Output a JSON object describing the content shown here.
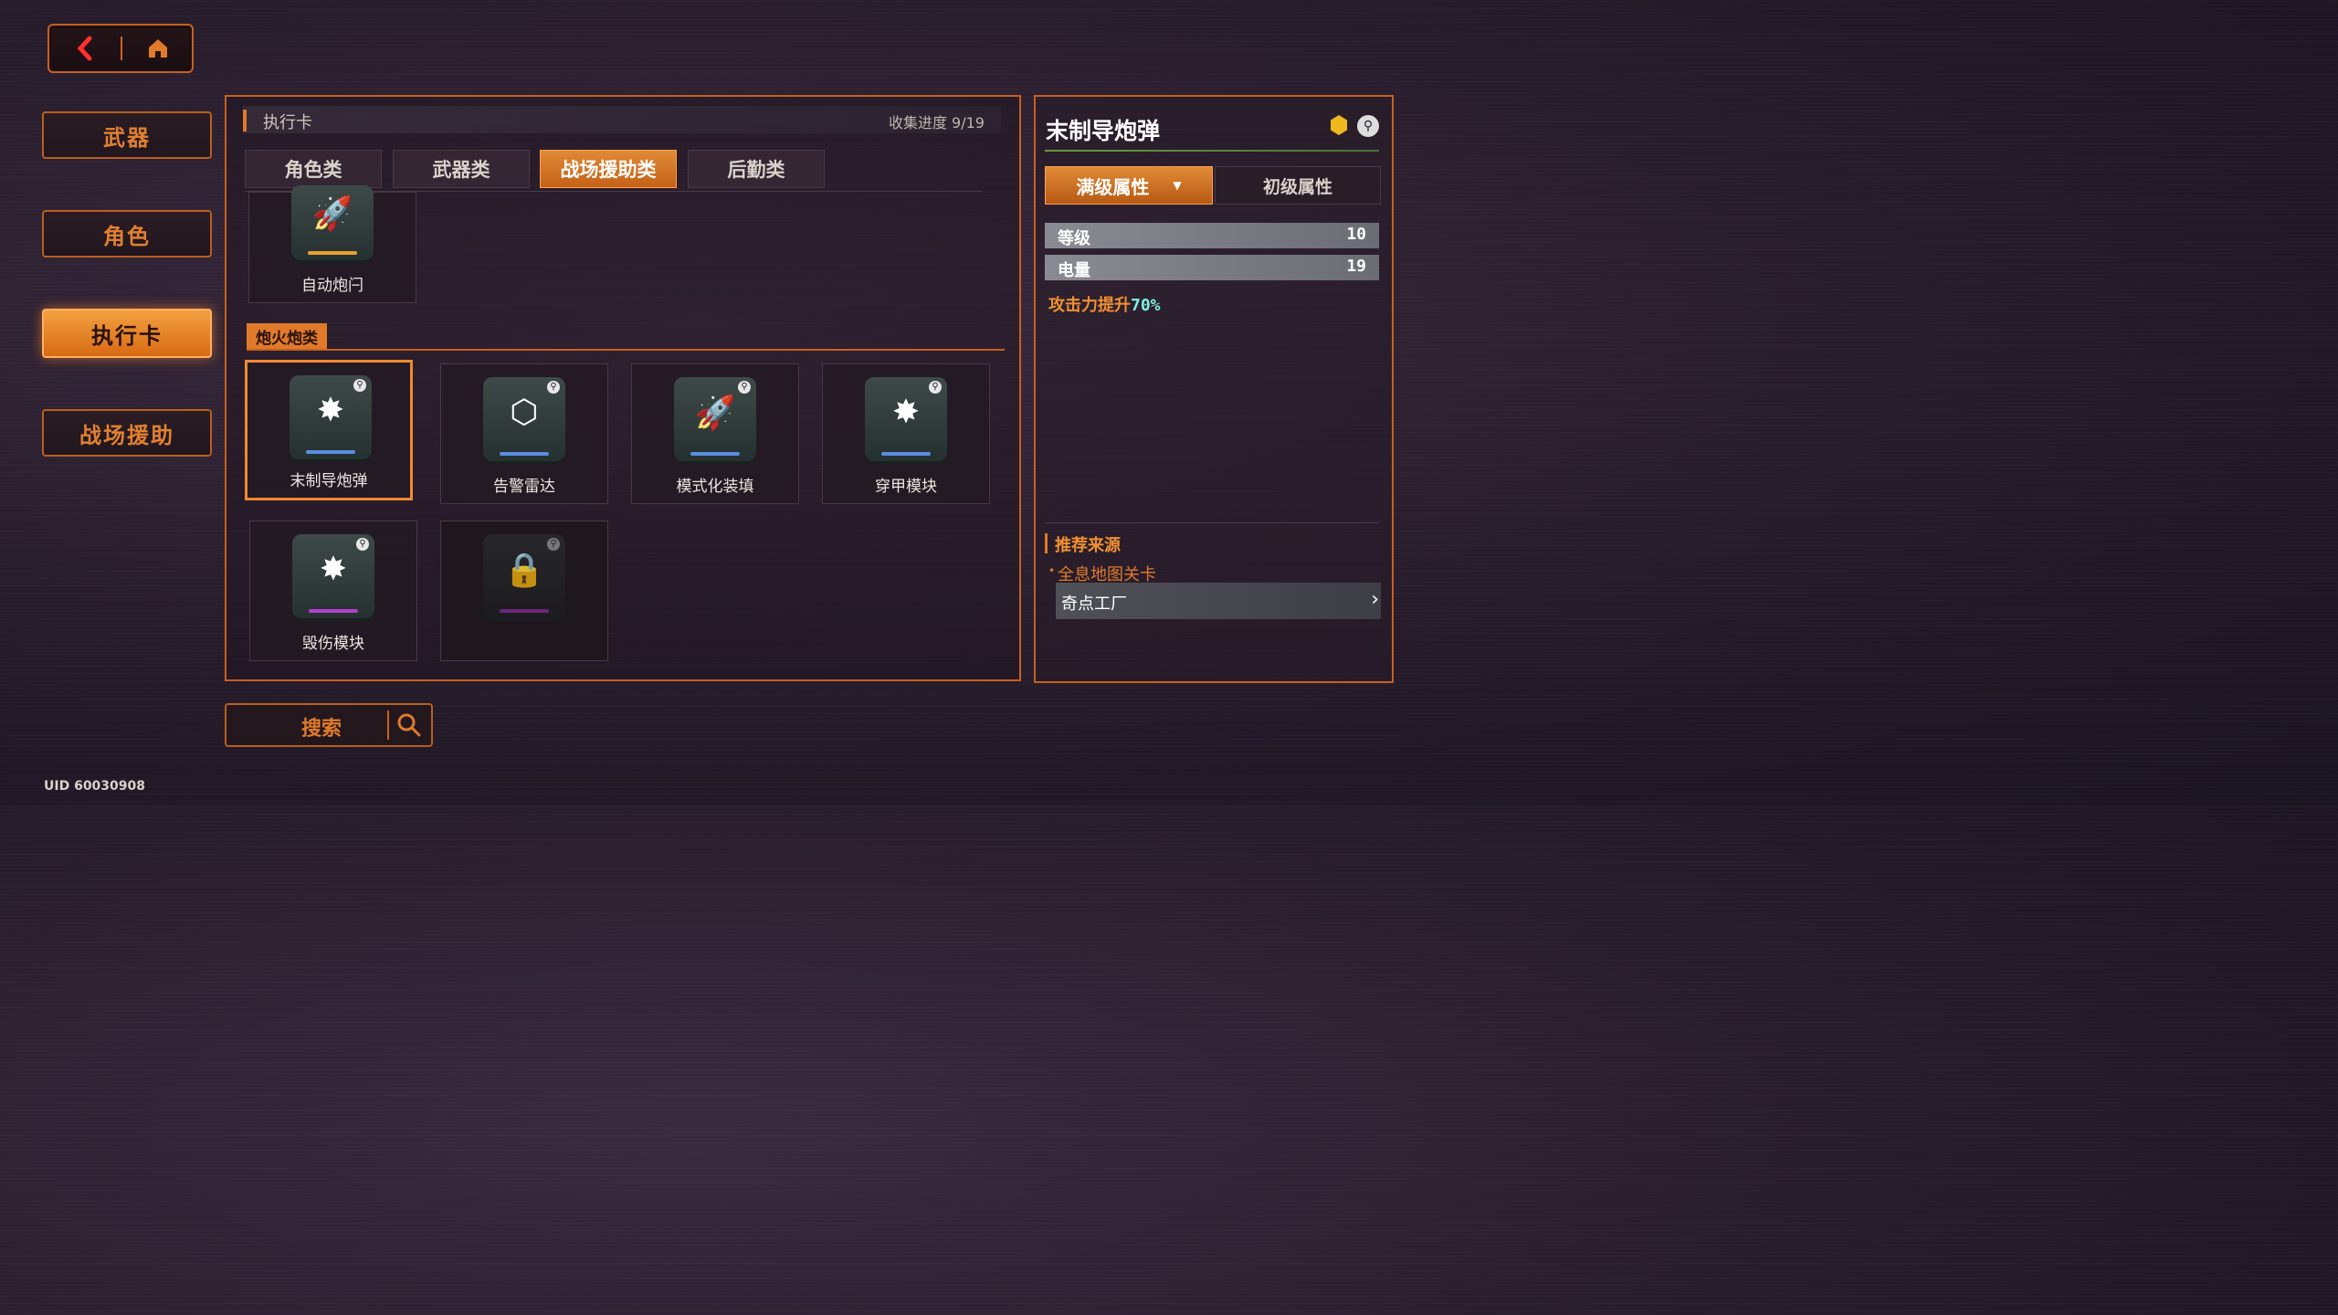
{
  "nav": {
    "back_icon": "back-arrow-icon",
    "home_icon": "home-icon"
  },
  "left_menu": [
    {
      "label": "武器",
      "active": false
    },
    {
      "label": "角色",
      "active": false
    },
    {
      "label": "执行卡",
      "active": true
    },
    {
      "label": "战场援助",
      "active": false
    }
  ],
  "main": {
    "header_title": "执行卡",
    "progress_label": "收集进度 9/19",
    "tabs": [
      {
        "label": "角色类",
        "active": false
      },
      {
        "label": "武器类",
        "active": false
      },
      {
        "label": "战场援助类",
        "active": true
      },
      {
        "label": "后勤类",
        "active": false
      }
    ],
    "top_card": {
      "name": "自动炮闩",
      "icon": "rocket-icon",
      "stripe": "#e8a030"
    },
    "section_label": "炮火炮类",
    "cards": [
      {
        "name": "末制导炮弹",
        "icon": "artillery-icon",
        "stripe": "#5a8ee0",
        "selected": true
      },
      {
        "name": "告警雷达",
        "icon": "radar-hexagon-icon",
        "stripe": "#5a8ee0",
        "selected": false
      },
      {
        "name": "模式化装填",
        "icon": "rocket-icon",
        "stripe": "#5a8ee0",
        "selected": false
      },
      {
        "name": "穿甲模块",
        "icon": "artillery-icon",
        "stripe": "#5a8ee0",
        "selected": false
      },
      {
        "name": "毁伤模块",
        "icon": "artillery-icon",
        "stripe": "#b040d0",
        "selected": false
      },
      {
        "name": "",
        "icon": "lock-icon",
        "stripe": "#b040d0",
        "locked": true
      }
    ]
  },
  "detail": {
    "title": "末制导炮弹",
    "badge_icon": "rarity-badge-icon",
    "pin_icon": "pin-icon",
    "tab_full": "满级属性",
    "tab_initial": "初级属性",
    "attrs": [
      {
        "key": "等级",
        "value": "10"
      },
      {
        "key": "电量",
        "value": "19"
      }
    ],
    "effect_prefix": "攻击力提升",
    "effect_value": "70%",
    "source_title": "推荐来源",
    "source_sub": "全息地图关卡",
    "source_item": "奇点工厂"
  },
  "search": {
    "label": "搜索",
    "icon": "search-icon"
  },
  "uid": "UID 60030908",
  "colors": {
    "accent": "#e07a2a",
    "highlight": "#f2a040",
    "effect_value": "#7ef0e0"
  }
}
